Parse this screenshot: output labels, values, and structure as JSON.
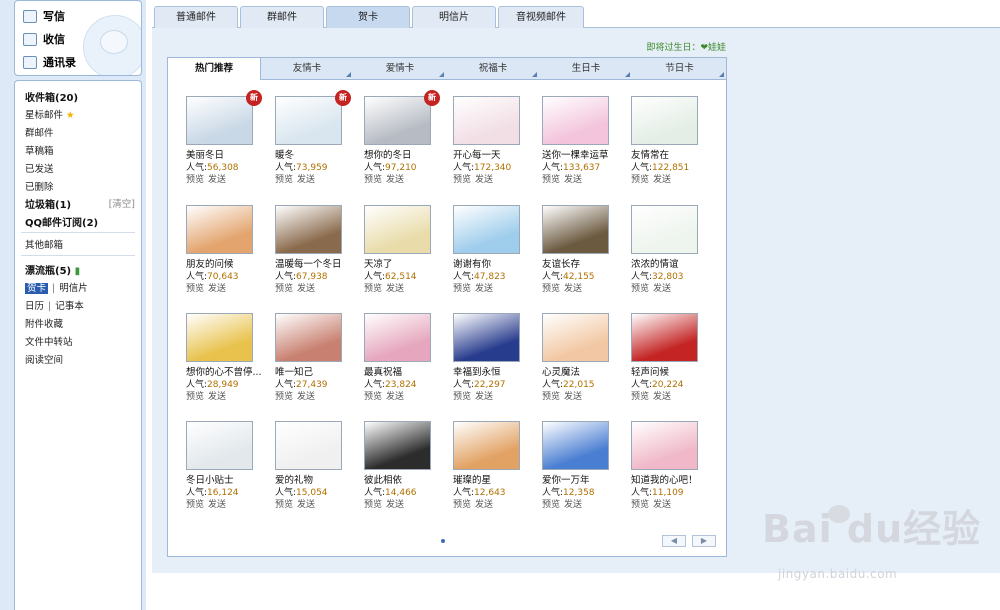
{
  "sidebar": {
    "top_buttons": [
      {
        "label": "写信",
        "icon": "pencil-icon"
      },
      {
        "label": "收信",
        "icon": "inbox-download-icon"
      },
      {
        "label": "通讯录",
        "icon": "addressbook-icon"
      }
    ],
    "menu": {
      "inbox": "收件箱(20)",
      "starred": "星标邮件",
      "group_mail": "群邮件",
      "drafts": "草稿箱",
      "sent": "已发送",
      "deleted": "已删除",
      "spam": "垃圾箱(1)",
      "spam_clear": "[清空]",
      "qq_subscribe": "QQ邮件订阅(2)",
      "other_mailbox": "其他邮箱",
      "drift_bottle": "漂流瓶(5)",
      "greeting_card": "贺卡",
      "postcard": "明信片",
      "calendar": "日历",
      "notepad": "记事本",
      "attachments": "附件收藏",
      "file_transfer": "文件中转站",
      "reading_space": "阅读空间"
    }
  },
  "tabs": [
    {
      "label": "普通邮件",
      "active": false
    },
    {
      "label": "群邮件",
      "active": false
    },
    {
      "label": "贺卡",
      "active": true
    },
    {
      "label": "明信片",
      "active": false
    },
    {
      "label": "音视频邮件",
      "active": false
    }
  ],
  "birthday_notice": "即将过生日：❤娃娃",
  "categories": [
    {
      "label": "热门推荐",
      "active": true
    },
    {
      "label": "友情卡",
      "active": false
    },
    {
      "label": "爱情卡",
      "active": false
    },
    {
      "label": "祝福卡",
      "active": false
    },
    {
      "label": "生日卡",
      "active": false
    },
    {
      "label": "节日卡",
      "active": false
    }
  ],
  "card_labels": {
    "popularity": "人气:",
    "preview": "预览",
    "send": "发送",
    "new_badge": "新"
  },
  "cards": [
    {
      "name": "美丽冬日",
      "pop": "56,308",
      "new": true
    },
    {
      "name": "暖冬",
      "pop": "73,959",
      "new": true
    },
    {
      "name": "想你的冬日",
      "pop": "97,210",
      "new": true
    },
    {
      "name": "开心每一天",
      "pop": "172,340",
      "new": false
    },
    {
      "name": "送你一棵幸运草",
      "pop": "133,637",
      "new": false
    },
    {
      "name": "友情常在",
      "pop": "122,851",
      "new": false
    },
    {
      "name": "朋友的问候",
      "pop": "70,643",
      "new": false
    },
    {
      "name": "温暖每一个冬日",
      "pop": "67,938",
      "new": false
    },
    {
      "name": "天凉了",
      "pop": "62,514",
      "new": false
    },
    {
      "name": "谢谢有你",
      "pop": "47,823",
      "new": false
    },
    {
      "name": "友谊长存",
      "pop": "42,155",
      "new": false
    },
    {
      "name": "浓浓的情谊",
      "pop": "32,803",
      "new": false
    },
    {
      "name": "想你的心不曾停...",
      "pop": "28,949",
      "new": false
    },
    {
      "name": "唯一知己",
      "pop": "27,439",
      "new": false
    },
    {
      "name": "最真祝福",
      "pop": "23,824",
      "new": false
    },
    {
      "name": "幸福到永恒",
      "pop": "22,297",
      "new": false
    },
    {
      "name": "心灵魔法",
      "pop": "22,015",
      "new": false
    },
    {
      "name": "轻声问候",
      "pop": "20,224",
      "new": false
    },
    {
      "name": "冬日小贴士",
      "pop": "16,124",
      "new": false
    },
    {
      "name": "爱的礼物",
      "pop": "15,054",
      "new": false
    },
    {
      "name": "彼此相依",
      "pop": "14,466",
      "new": false
    },
    {
      "name": "璀璨的星",
      "pop": "12,643",
      "new": false
    },
    {
      "name": "爱你一万年",
      "pop": "12,358",
      "new": false
    },
    {
      "name": "知道我的心吧！",
      "pop": "11,109",
      "new": false
    }
  ],
  "thumb_colors": [
    "#c9d8e6",
    "#d9e6ef",
    "#b7bcc4",
    "#f2dfe6",
    "#f3c4dc",
    "#e4eee6",
    "#e3a46e",
    "#8a6a4c",
    "#e9dcaa",
    "#9fcdec",
    "#6c5a40",
    "#eef4ee",
    "#e8c24c",
    "#c88070",
    "#e6a6bd",
    "#283c8e",
    "#f2c8a4",
    "#c42424",
    "#e2e8ec",
    "#f0f0f0",
    "#2c2c2c",
    "#e2a264",
    "#4a7ed2",
    "#f0b8c8"
  ],
  "watermark": {
    "main": "Bai du经验",
    "sub": "jingyan.baidu.com"
  }
}
